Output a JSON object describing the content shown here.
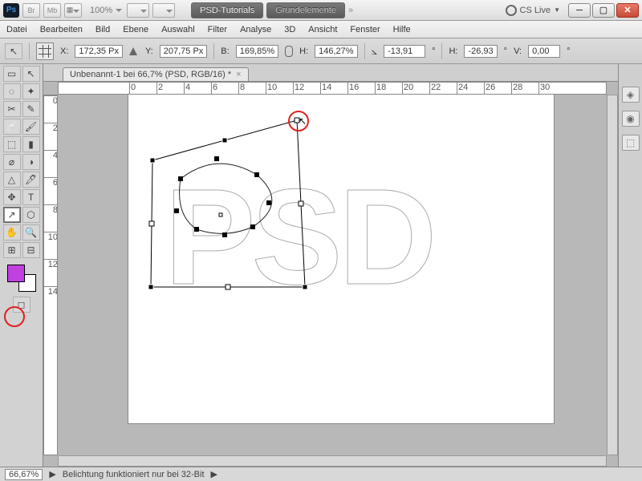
{
  "titlebar": {
    "ps": "Ps",
    "br": "Br",
    "mb": "Mb",
    "zoom": "100%",
    "tab1": "PSD-Tutorials",
    "tab2": "Grundelemente",
    "more": "»",
    "cslive": "CS Live"
  },
  "menu": [
    "Datei",
    "Bearbeiten",
    "Bild",
    "Ebene",
    "Auswahl",
    "Filter",
    "Analyse",
    "3D",
    "Ansicht",
    "Fenster",
    "Hilfe"
  ],
  "options": {
    "x_label": "X:",
    "x": "172,35 Px",
    "y_label": "Y:",
    "y": "207,75 Px",
    "w_label": "B:",
    "w": "169,85%",
    "h_label": "H:",
    "h": "146,27%",
    "angle": "-13,91",
    "h2_label": "H:",
    "h2": "-26,93",
    "v_label": "V:",
    "v": "0,00",
    "deg": "°"
  },
  "doc": {
    "title": "Unbenannt-1 bei 66,7% (PSD, RGB/16) *"
  },
  "ruler_h": [
    0,
    2,
    4,
    6,
    8,
    10,
    12,
    14,
    16,
    18,
    20,
    22,
    24,
    26,
    28,
    30
  ],
  "ruler_v": [
    0,
    2,
    4,
    6,
    8,
    10,
    12,
    14
  ],
  "status": {
    "zoom": "66,67%",
    "msg": "Belichtung funktioniert nur bei 32-Bit"
  },
  "tools": [
    "▭",
    "↖",
    "◌",
    "✦",
    "✂",
    "✎",
    "🩹",
    "🖌",
    "⬚",
    "▮",
    "⌀",
    "◑",
    "△",
    "🖊",
    "✥",
    "T",
    "↗",
    "⬡",
    "✋",
    "🔍",
    "⊞",
    "⊟"
  ],
  "right_icons": [
    "◈",
    "◉",
    "⬚"
  ]
}
